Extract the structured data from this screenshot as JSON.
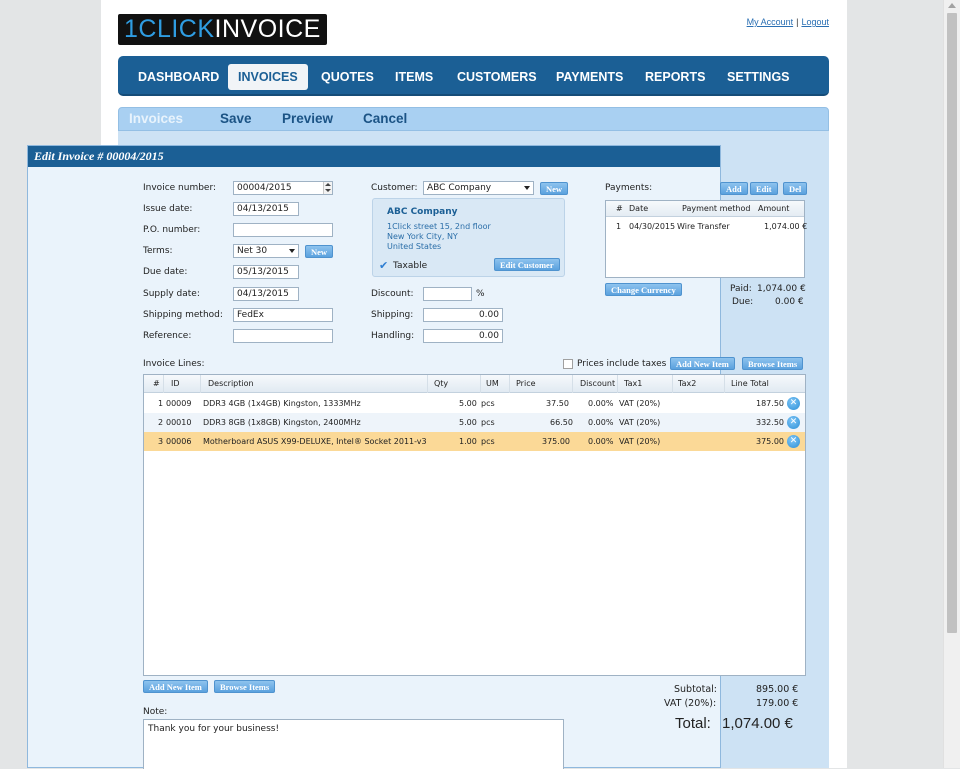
{
  "brand": {
    "part1": "1CLICK",
    "part2": "INVOICE",
    "accent": "#2f9de2"
  },
  "account": {
    "my_account": "My Account",
    "separator": "|",
    "logout": "Logout"
  },
  "nav": {
    "items": [
      "DASHBOARD",
      "INVOICES",
      "QUOTES",
      "ITEMS",
      "CUSTOMERS",
      "PAYMENTS",
      "REPORTS",
      "SETTINGS"
    ],
    "active": "INVOICES"
  },
  "toolbar": {
    "current": "Invoices",
    "save": "Save",
    "preview": "Preview",
    "cancel": "Cancel"
  },
  "panel": {
    "title": "Edit Invoice # 00004/2015"
  },
  "form": {
    "invoice_number_label": "Invoice number:",
    "invoice_number": "00004/2015",
    "issue_date_label": "Issue date:",
    "issue_date": "04/13/2015",
    "po_label": "P.O. number:",
    "po": "",
    "terms_label": "Terms:",
    "terms": "Net 30",
    "terms_new": "New",
    "due_date_label": "Due date:",
    "due_date": "05/13/2015",
    "supply_date_label": "Supply date:",
    "supply_date": "04/13/2015",
    "shipping_method_label": "Shipping method:",
    "shipping_method": "FedEx",
    "reference_label": "Reference:",
    "reference": ""
  },
  "customer": {
    "label": "Customer:",
    "selected": "ABC Company",
    "new": "New",
    "name": "ABC Company",
    "address": [
      "1Click street 15, 2nd floor",
      "New York City, NY",
      "United States"
    ],
    "taxable_label": "Taxable",
    "taxable": true,
    "edit_button": "Edit Customer"
  },
  "charges": {
    "discount_label": "Discount:",
    "discount": "",
    "discount_unit": "%",
    "shipping_label": "Shipping:",
    "shipping": "0.00",
    "handling_label": "Handling:",
    "handling": "0.00"
  },
  "payments": {
    "label": "Payments:",
    "add": "Add",
    "edit": "Edit",
    "del": "Del",
    "headers": [
      "#",
      "Date",
      "Payment method",
      "Amount"
    ],
    "rows": [
      {
        "n": "1",
        "date": "04/30/2015",
        "method": "Wire Transfer",
        "amount": "1,074.00 €"
      }
    ],
    "change_currency": "Change Currency",
    "paid_label": "Paid:",
    "paid": "1,074.00 €",
    "due_label": "Due:",
    "due": "0.00 €"
  },
  "lines": {
    "label": "Invoice Lines:",
    "prices_include_taxes": "Prices include taxes",
    "add_new_item": "Add New Item",
    "browse_items": "Browse Items",
    "headers": [
      "#",
      "ID",
      "Description",
      "Qty",
      "UM",
      "Price",
      "Discount",
      "Tax1",
      "Tax2",
      "Line Total"
    ],
    "rows": [
      {
        "n": "1",
        "id": "00009",
        "desc": "DDR3 4GB (1x4GB) Kingston, 1333MHz",
        "qty": "5.00",
        "um": "pcs",
        "price": "37.50",
        "discount": "0.00%",
        "tax1": "VAT (20%)",
        "tax2": "",
        "total": "187.50"
      },
      {
        "n": "2",
        "id": "00010",
        "desc": "DDR3 8GB (1x8GB) Kingston, 2400MHz",
        "qty": "5.00",
        "um": "pcs",
        "price": "66.50",
        "discount": "0.00%",
        "tax1": "VAT (20%)",
        "tax2": "",
        "total": "332.50"
      },
      {
        "n": "3",
        "id": "00006",
        "desc": "Motherboard ASUS X99-DELUXE, Intel® Socket 2011-v3",
        "qty": "1.00",
        "um": "pcs",
        "price": "375.00",
        "discount": "0.00%",
        "tax1": "VAT (20%)",
        "tax2": "",
        "total": "375.00"
      }
    ],
    "selected_row": 3
  },
  "totals": {
    "subtotal_label": "Subtotal:",
    "subtotal": "895.00 €",
    "vat_label": "VAT (20%):",
    "vat": "179.00 €",
    "total_label": "Total:",
    "total": "1,074.00 €"
  },
  "note": {
    "label": "Note:",
    "text": "Thank you for your business!"
  },
  "colors": {
    "nav_bg": "#1b5f95",
    "toolbar_bg": "#a9d0f2",
    "selected_row": "#fbd997",
    "button": "#5ba1de"
  }
}
